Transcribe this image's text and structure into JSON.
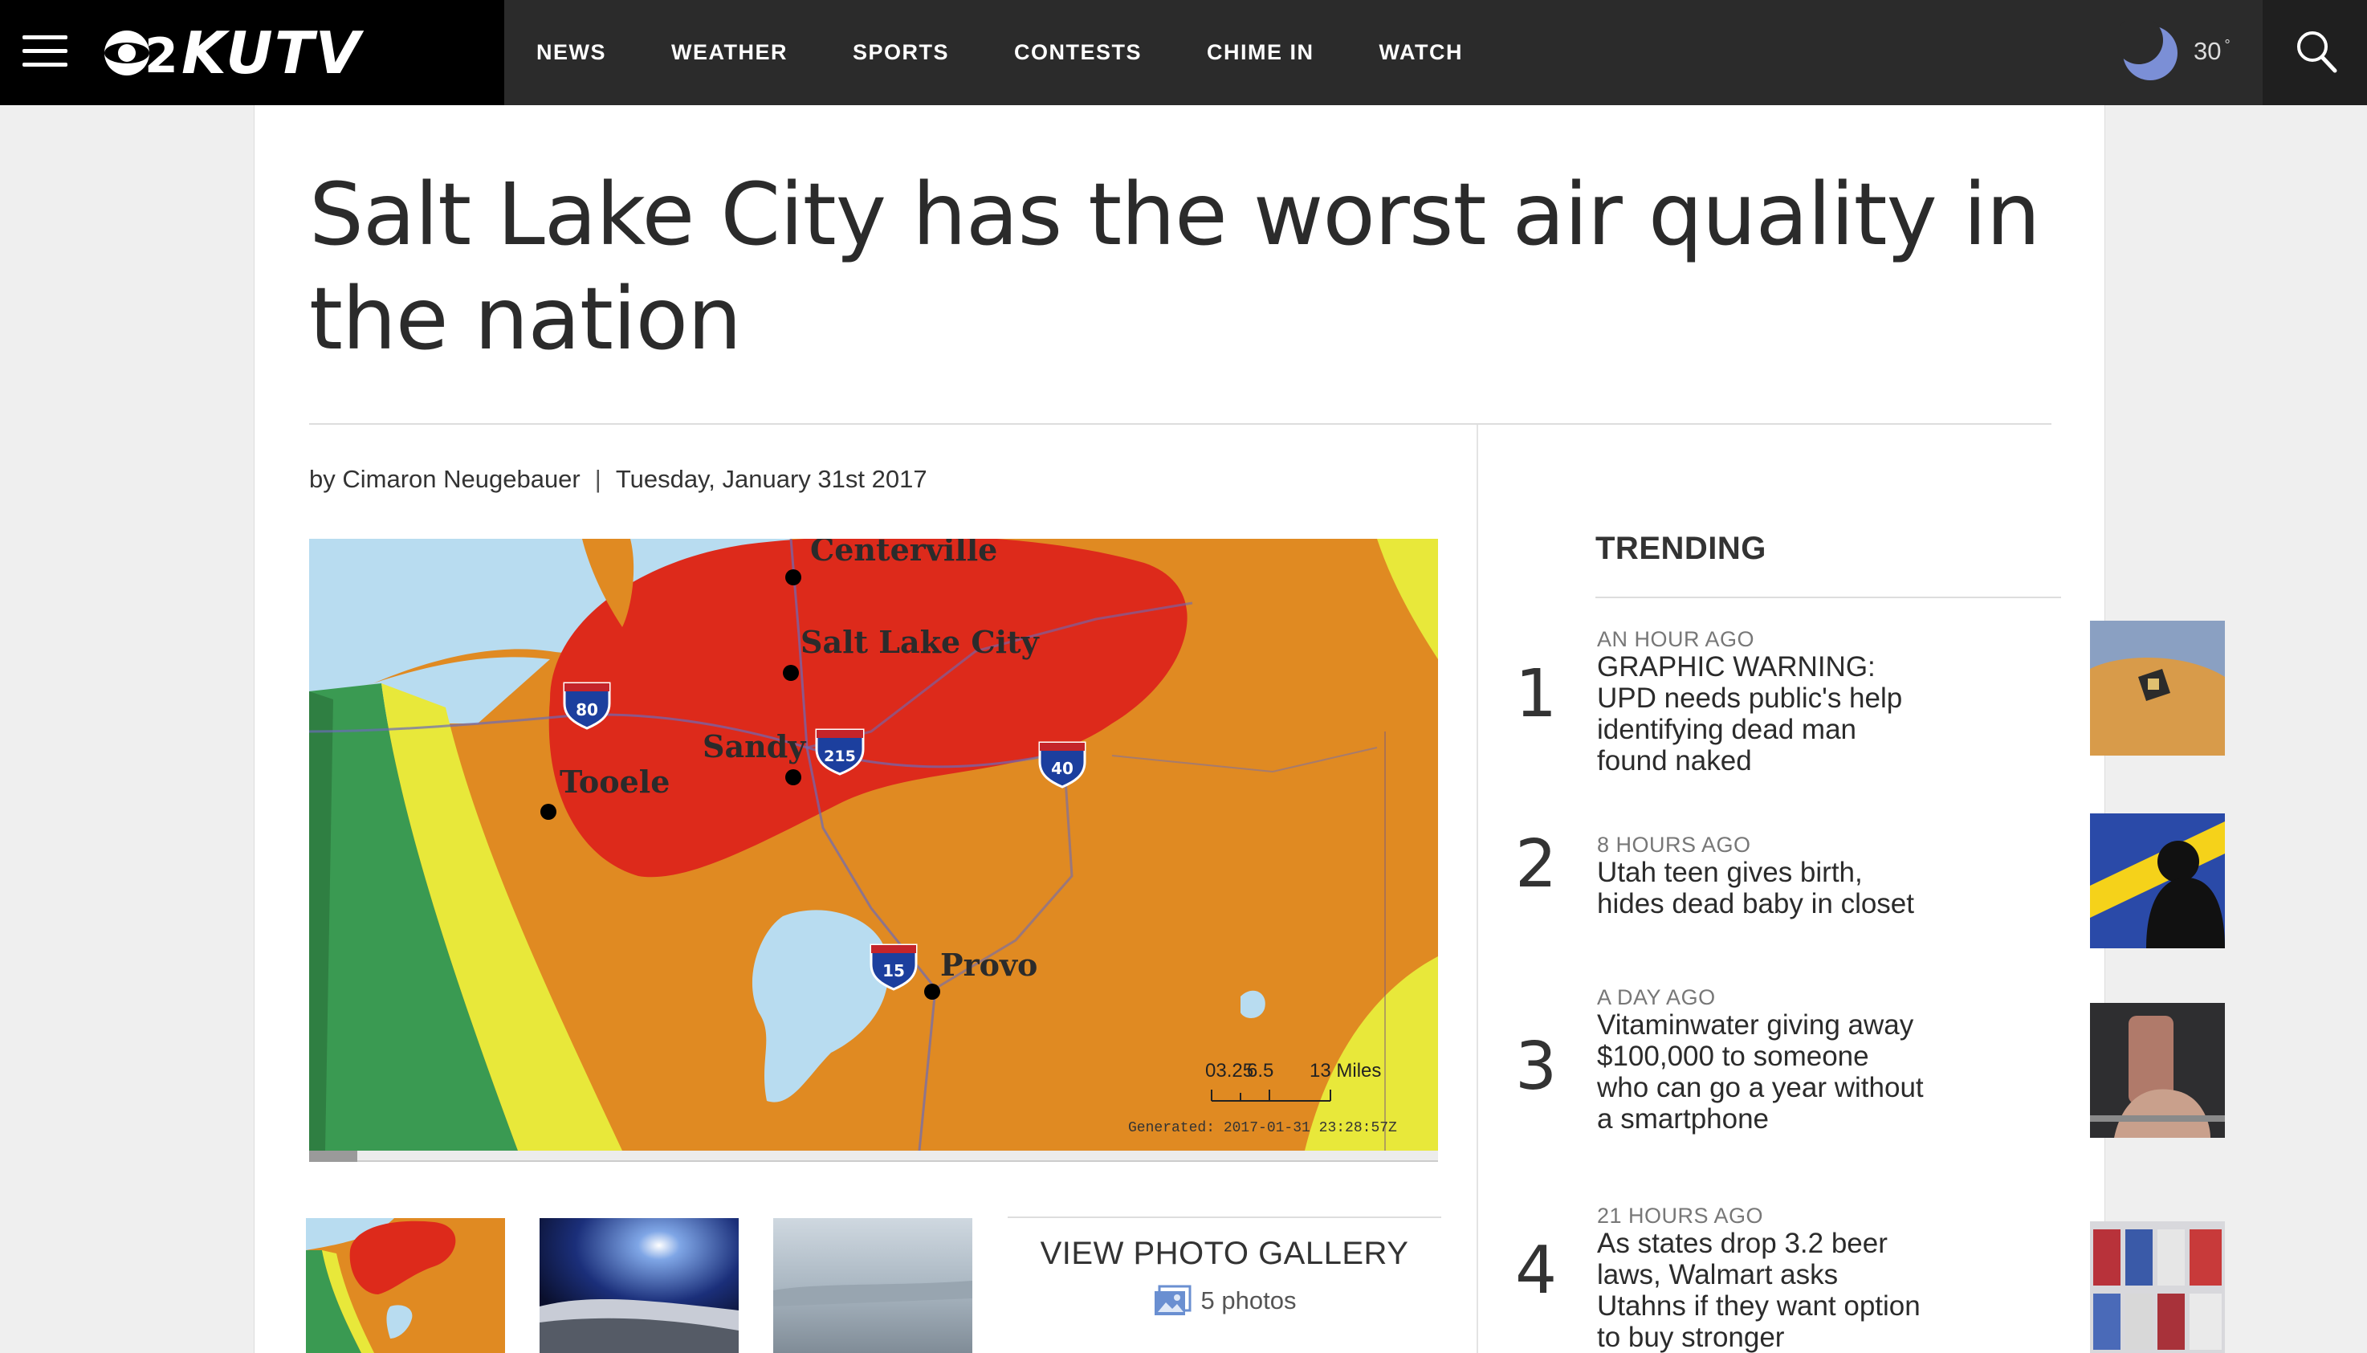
{
  "nav": {
    "logo_text": "KUTV",
    "logo_number": "2",
    "items": [
      "NEWS",
      "WEATHER",
      "SPORTS",
      "CONTESTS",
      "CHIME IN",
      "WATCH"
    ],
    "temperature": "30",
    "degree": "°"
  },
  "article": {
    "headline": "Salt Lake City has the worst air quality in the nation",
    "byline": "by Cimaron Neugebauer",
    "separator": "|",
    "date": "Tuesday, January 31st 2017",
    "map_labels": {
      "centerville": "Centerville",
      "slc": "Salt Lake City",
      "sandy": "Sandy",
      "tooele": "Tooele",
      "provo": "Provo",
      "i80": "80",
      "i215": "215",
      "i40": "40",
      "i15": "15",
      "scale_left": "03.25",
      "scale_mid": "6.5",
      "scale_right": "13 Miles",
      "generated": "Generated: 2017-01-31 23:28:57Z"
    }
  },
  "gallery": {
    "label": "VIEW PHOTO GALLERY",
    "count": "5 photos"
  },
  "trending": {
    "title": "TRENDING",
    "items": [
      {
        "num": "1",
        "time": "AN HOUR AGO",
        "title": "GRAPHIC WARNING: UPD needs public's help identifying dead man found naked"
      },
      {
        "num": "2",
        "time": "8 HOURS AGO",
        "title": "Utah teen gives birth, hides dead baby in closet"
      },
      {
        "num": "3",
        "time": "A DAY AGO",
        "title": "Vitaminwater giving away $100,000 to someone who can go a year without a smartphone"
      },
      {
        "num": "4",
        "time": "21 HOURS AGO",
        "title": "As states drop 3.2 beer laws, Walmart asks Utahns if they want option to buy stronger"
      }
    ]
  },
  "colors": {
    "nav_bg": "#2b2b2b",
    "logo_bg": "#000000",
    "map_red": "#dd2a1b",
    "map_orange": "#e08a22",
    "map_yellow": "#e8e83a",
    "map_water": "#b8dcf0",
    "moon": "#7b8fd6"
  }
}
